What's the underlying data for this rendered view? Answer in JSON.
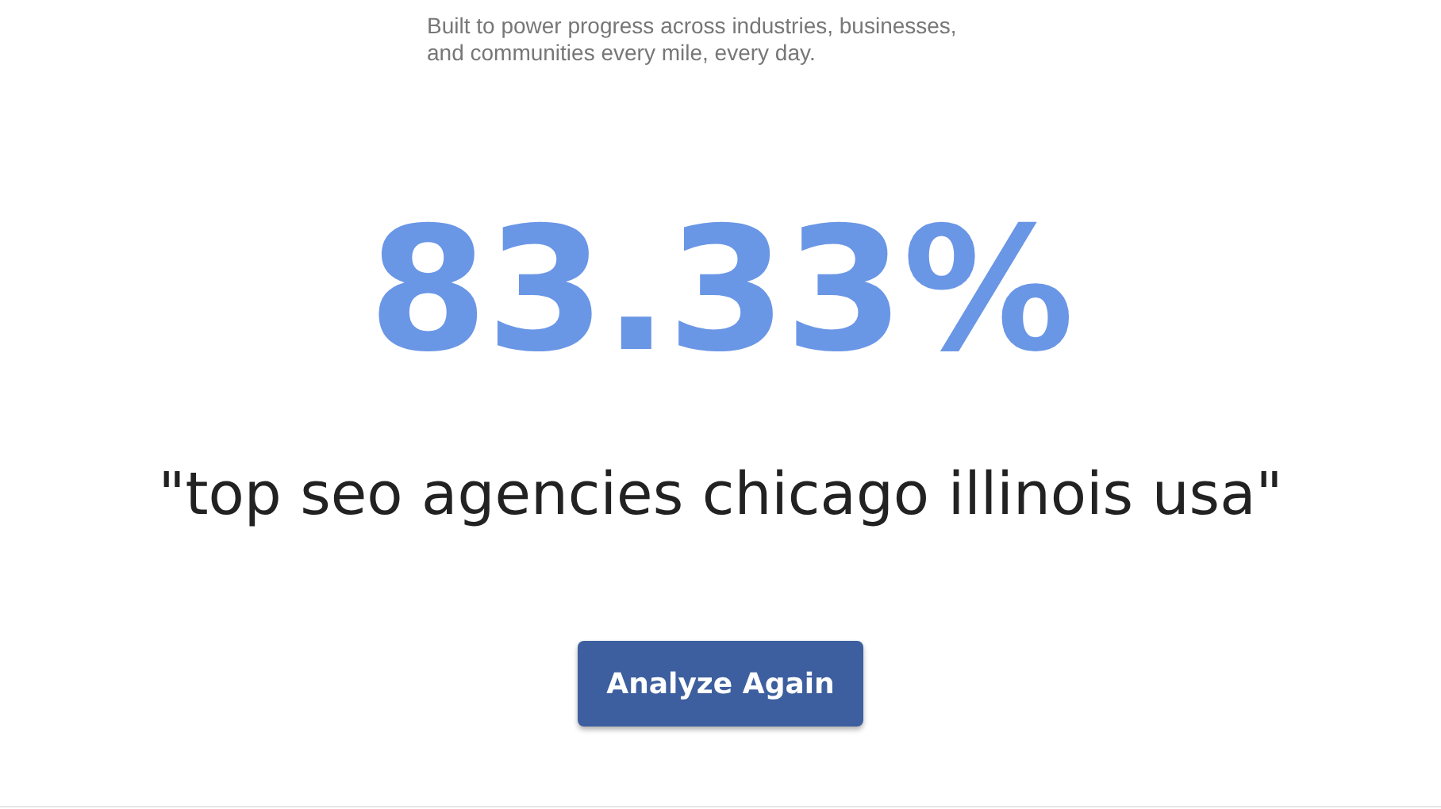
{
  "tagline": "Built to power progress across industries, businesses, and communities every mile, every day.",
  "result": {
    "percentage": "83.33%",
    "query": "\"top seo agencies chicago illinois usa\""
  },
  "buttons": [
    "Analyze Again"
  ]
}
